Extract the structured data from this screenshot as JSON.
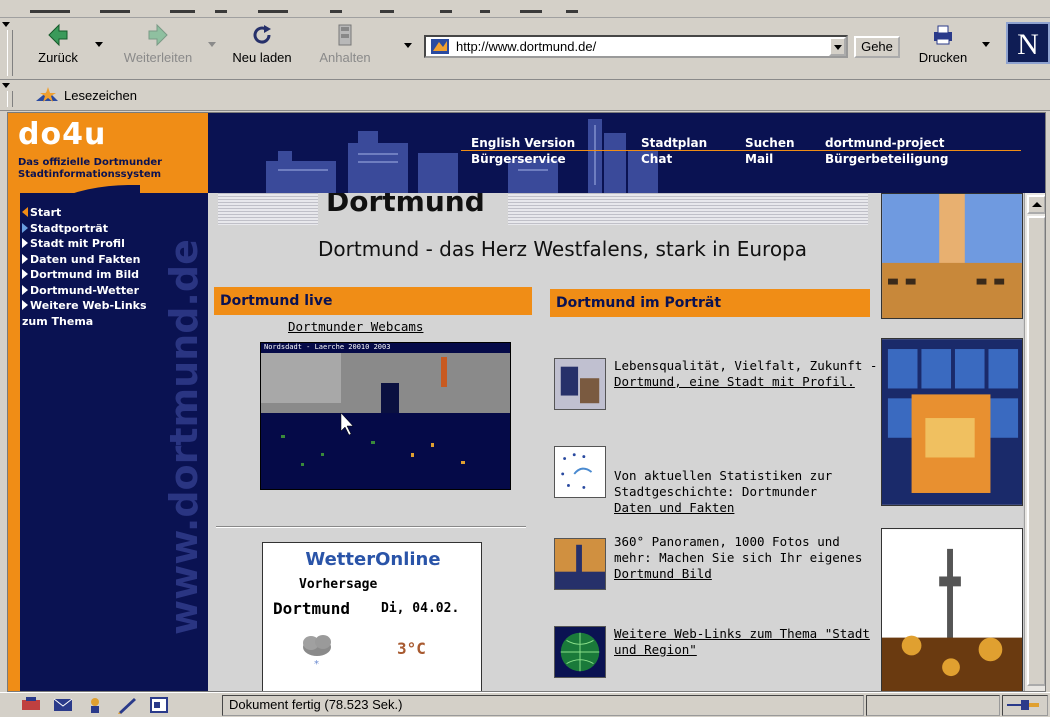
{
  "toolbar": {
    "back": "Zurück",
    "forward": "Weiterleiten",
    "reload": "Neu laden",
    "stop": "Anhalten",
    "url": "http://www.dortmund.de/",
    "go": "Gehe",
    "print": "Drucken",
    "brand_letter": "N"
  },
  "bookmarks": {
    "label": "Lesezeichen"
  },
  "site": {
    "logo": "do4u",
    "logo_sub_1": "Das offizielle Dortmunder",
    "logo_sub_2": "Stadtinformationssystem",
    "watermark": "www.dortmund.de",
    "side_nav": [
      "Start",
      "Stadtporträt",
      "Stadt mit Profil",
      "Daten und Fakten",
      "Dortmund im Bild",
      "Dortmund-Wetter",
      "Weitere Web-Links",
      "zum Thema"
    ],
    "top_nav": {
      "english": "English Version",
      "buergerservice": "Bürgerservice",
      "stadtplan": "Stadtplan",
      "chat": "Chat",
      "suchen": "Suchen",
      "mail": "Mail",
      "project": "dortmund-project",
      "beteiligung": "Bürgerbeteiligung"
    },
    "title": "Dortmund",
    "tagline": "Dortmund - das Herz Westfalens, stark in Europa",
    "live": {
      "heading": "Dortmund live",
      "webcam_link": "Dortmunder Webcams",
      "webcam_caption": "Nordsdadt - Laerche   20010 2003"
    },
    "weather": {
      "brand": "WetterOnline",
      "forecast": "Vorhersage",
      "city": "Dortmund",
      "date": "Di, 04.02.",
      "temp": "3°C"
    },
    "portrait": {
      "heading": "Dortmund im Porträt",
      "items": [
        {
          "text": "Lebensqualität, Vielfalt, Zukunft -",
          "link": "Dortmund, eine Stadt mit Profil."
        },
        {
          "text": "Von aktuellen Statistiken zur Stadtgeschichte: Dortmunder",
          "link": "Daten und Fakten"
        },
        {
          "text": "360° Panoramen, 1000 Fotos und mehr: Machen Sie sich Ihr eigenes",
          "link": "Dortmund Bild"
        },
        {
          "text": "",
          "link": "Weitere Web-Links zum Thema \"Stadt und Region\""
        }
      ]
    }
  },
  "status": {
    "text": "Dokument fertig (78.523 Sek.)"
  }
}
